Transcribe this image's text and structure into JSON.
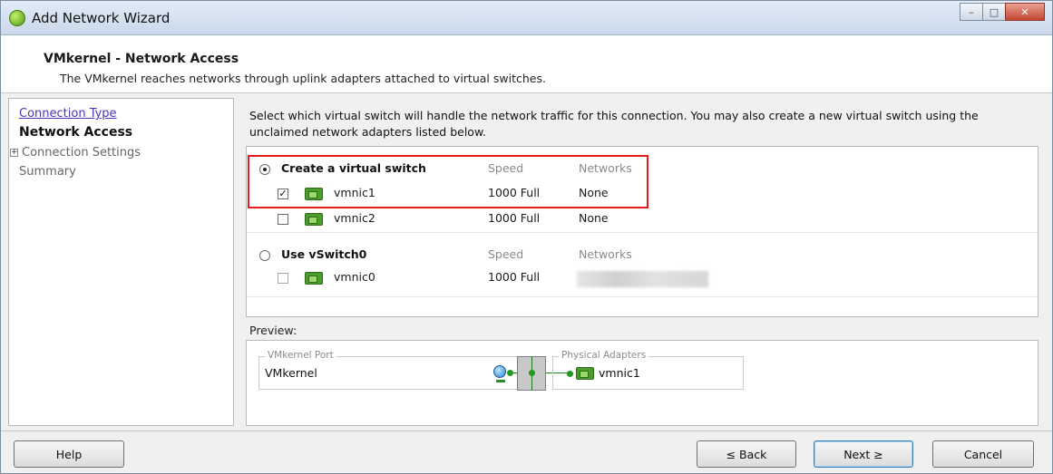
{
  "window": {
    "title": "Add Network Wizard"
  },
  "header": {
    "title": "VMkernel - Network Access",
    "subtitle": "The VMkernel reaches networks through uplink adapters attached to virtual switches."
  },
  "nav": {
    "items": [
      {
        "label": "Connection Type",
        "state": "link"
      },
      {
        "label": "Network Access",
        "state": "current"
      },
      {
        "label": "Connection Settings",
        "state": "pending",
        "expander": "+"
      },
      {
        "label": "Summary",
        "state": "pending"
      }
    ]
  },
  "main": {
    "instructions": "Select which virtual switch will handle the network traffic for this connection. You may also create a new virtual switch using the unclaimed network adapters listed below.",
    "options": [
      {
        "label": "Create a virtual switch",
        "selected": true,
        "speed_header": "Speed",
        "networks_header": "Networks",
        "adapters": [
          {
            "name": "vmnic1",
            "checked": true,
            "speed": "1000 Full",
            "networks": "None"
          },
          {
            "name": "vmnic2",
            "checked": false,
            "speed": "1000 Full",
            "networks": "None"
          }
        ]
      },
      {
        "label": "Use vSwitch0",
        "selected": false,
        "speed_header": "Speed",
        "networks_header": "Networks",
        "adapters": [
          {
            "name": "vmnic0",
            "checked": false,
            "speed": "1000 Full",
            "networks": ""
          }
        ]
      }
    ]
  },
  "preview": {
    "label": "Preview:",
    "port_group_legend": "VMkernel Port",
    "port_name": "VMkernel",
    "adapters_legend": "Physical Adapters",
    "adapter_name": "vmnic1"
  },
  "footer": {
    "help": "Help",
    "back": "≤ Back",
    "next": "Next ≥",
    "cancel": "Cancel"
  },
  "colors": {
    "highlight_border": "#e21b1b",
    "link": "#4a36b8",
    "nic_green": "#4a9c2b"
  }
}
